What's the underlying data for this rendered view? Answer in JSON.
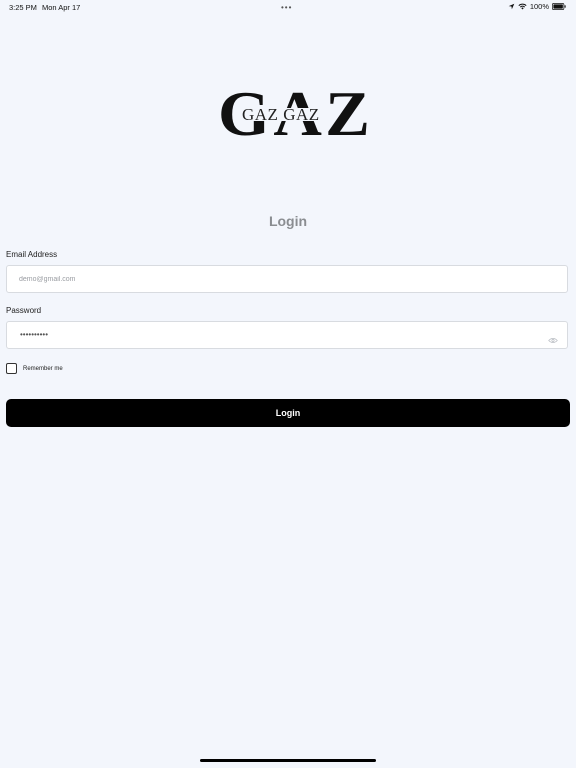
{
  "status_bar": {
    "time": "3:25 PM",
    "date": "Mon Apr 17",
    "dots": "•••",
    "battery": "100%"
  },
  "logo": {
    "big": "GAZ",
    "small": "GAZ GAZ"
  },
  "login": {
    "title": "Login",
    "email_label": "Email Address",
    "email_placeholder": "demo@gmail.com",
    "password_label": "Password",
    "password_value": "••••••••••",
    "remember_label": "Remember me",
    "button_label": "Login"
  },
  "icons": {
    "location": "location-arrow-icon",
    "wifi": "wifi-icon",
    "battery": "battery-icon",
    "eye": "eye-icon"
  }
}
